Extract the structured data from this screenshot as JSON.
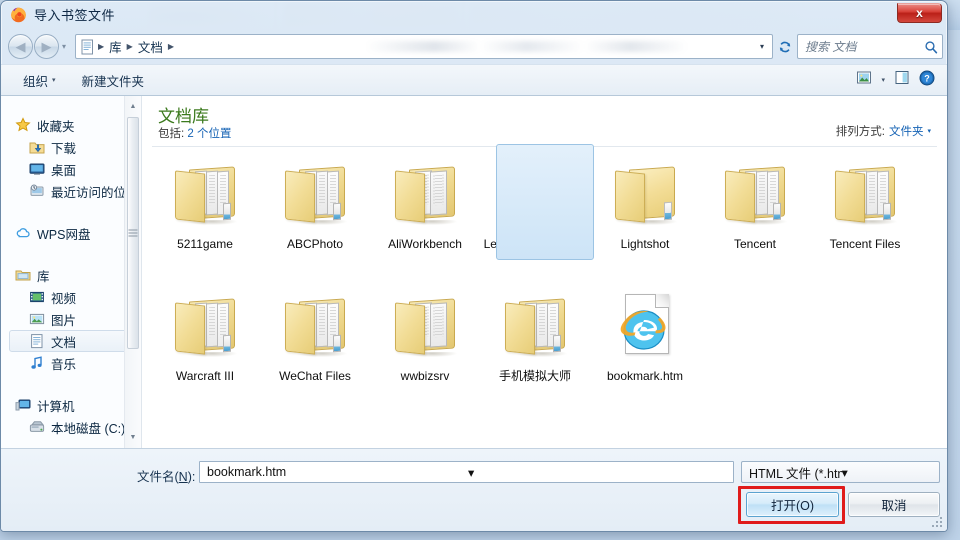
{
  "window": {
    "title": "导入书签文件",
    "app_icon": "firefox-icon",
    "close_label": "x"
  },
  "navbar": {
    "back_icon": "back-arrow-icon",
    "forward_icon": "forward-arrow-icon",
    "history_caret": "▾",
    "breadcrumb_icon": "library-document-icon",
    "breadcrumb": [
      "库",
      "文档"
    ],
    "crumb_separator": "▶",
    "dropdown_caret": "▾",
    "refresh_icon": "refresh-icon",
    "search_placeholder": "搜索 文档",
    "search_icon": "search-icon"
  },
  "toolbar": {
    "organize_label": "组织",
    "organize_caret": "▾",
    "new_folder_label": "新建文件夹",
    "view_icon": "view-mode-icon",
    "view_caret": "▾",
    "preview_pane_icon": "preview-pane-icon",
    "help_icon": "help-icon"
  },
  "sidebar": {
    "scroll_up": "▲",
    "scroll_down": "▼",
    "groups": [
      {
        "header": {
          "label": "收藏夹",
          "icon": "star-icon"
        },
        "items": [
          {
            "label": "下载",
            "icon": "downloads-icon"
          },
          {
            "label": "桌面",
            "icon": "desktop-icon"
          },
          {
            "label": "最近访问的位置",
            "icon": "recent-places-icon"
          }
        ]
      },
      {
        "header": {
          "label": "WPS网盘",
          "icon": "cloud-icon"
        },
        "items": []
      },
      {
        "header": {
          "label": "库",
          "icon": "library-icon"
        },
        "items": [
          {
            "label": "视频",
            "icon": "video-icon",
            "selected": false
          },
          {
            "label": "图片",
            "icon": "pictures-icon",
            "selected": false
          },
          {
            "label": "文档",
            "icon": "documents-icon",
            "selected": true
          },
          {
            "label": "音乐",
            "icon": "music-icon",
            "selected": false
          }
        ]
      },
      {
        "header": {
          "label": "计算机",
          "icon": "computer-icon"
        },
        "items": [
          {
            "label": "本地磁盘 (C:)",
            "icon": "harddisk-icon"
          }
        ]
      }
    ]
  },
  "library": {
    "title": "文档库",
    "subtitle_prefix": "包括: ",
    "subtitle_link": "2 个位置",
    "arrange_label": "排列方式:",
    "arrange_value": "文件夹",
    "arrange_caret": "▾"
  },
  "files": {
    "rows": [
      [
        {
          "name": "5211game",
          "type": "folder",
          "icon": "folder-icon",
          "selected": false
        },
        {
          "name": "ABCPhoto",
          "type": "folder",
          "icon": "folder-icon",
          "selected": false
        },
        {
          "name": "AliWorkbench",
          "type": "folder-docs",
          "icon": "folder-documents-icon",
          "selected": false
        },
        {
          "name": "League of Legends",
          "type": "folder",
          "icon": "folder-icon",
          "selected": false
        },
        {
          "name": "Lightshot",
          "type": "folder-empty",
          "icon": "folder-empty-icon",
          "selected": false
        },
        {
          "name": "Tencent",
          "type": "folder",
          "icon": "folder-icon",
          "selected": false
        },
        {
          "name": "Tencent Files",
          "type": "folder",
          "icon": "folder-icon",
          "selected": false
        }
      ],
      [
        {
          "name": "Warcraft III",
          "type": "folder",
          "icon": "folder-icon",
          "selected": false
        },
        {
          "name": "WeChat Files",
          "type": "folder",
          "icon": "folder-icon",
          "selected": false
        },
        {
          "name": "wwbizsrv",
          "type": "folder-docs",
          "icon": "folder-documents-icon",
          "selected": false
        },
        {
          "name": "手机模拟大师",
          "type": "folder",
          "icon": "folder-icon",
          "selected": false
        },
        {
          "name": "bookmark.htm",
          "type": "file-html",
          "icon": "internet-explorer-file-icon",
          "selected": true
        }
      ]
    ]
  },
  "footer": {
    "filename_label": "文件名(N):",
    "filename_label_plain": "文件名(",
    "filename_label_key": "N",
    "filename_label_end": "):",
    "filename_value": "bookmark.htm",
    "filename_caret": "▾",
    "filetype_value": "HTML 文件 (*.html;*.htm;*.sht",
    "filetype_caret": "▾",
    "open_button": "打开(O)",
    "cancel_button": "取消"
  },
  "annotation": {
    "highlight_color": "#e01b1b",
    "target": "open-button"
  }
}
